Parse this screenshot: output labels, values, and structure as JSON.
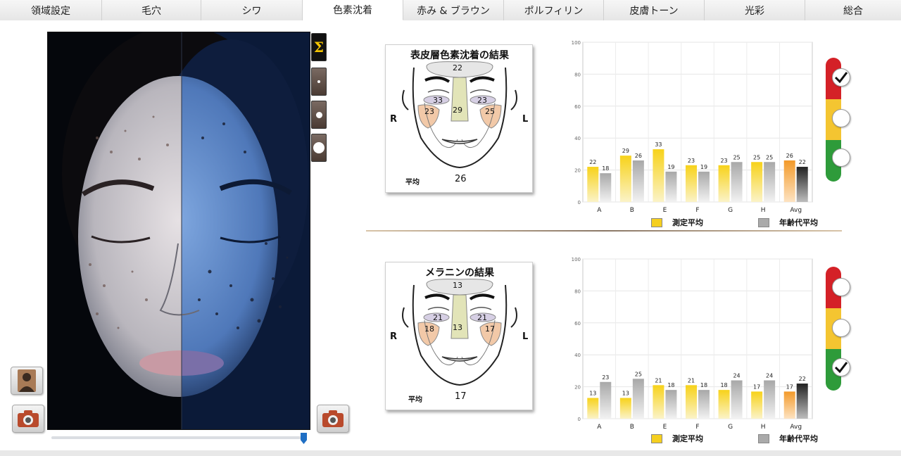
{
  "tabs": [
    {
      "label": "領域設定",
      "active": false
    },
    {
      "label": "毛穴",
      "active": false
    },
    {
      "label": "シワ",
      "active": false
    },
    {
      "label": "色素沈着",
      "active": true
    },
    {
      "label": "赤み & ブラウン",
      "active": false
    },
    {
      "label": "ポルフィリン",
      "active": false
    },
    {
      "label": "皮膚トーン",
      "active": false
    },
    {
      "label": "光彩",
      "active": false
    },
    {
      "label": "総合",
      "active": false
    }
  ],
  "toolbar": {
    "sigma_label": "Σ",
    "icons": [
      "sigma-icon",
      "small-dot-icon",
      "medium-dot-icon",
      "large-dot-icon"
    ]
  },
  "photo": {
    "slider_value": 0.98
  },
  "colors": {
    "measured": "#f5cf1f",
    "age_avg": "#b5b5b5",
    "avg_measured": "#f39a2a",
    "avg_age": "#222222",
    "red": "#d42127",
    "yellow": "#f4c531",
    "green": "#2e9b3a"
  },
  "epidermal": {
    "title": "表皮層色素沈着の結果",
    "left_side": "R",
    "right_side": "L",
    "avg_label": "平均",
    "avg_value": "26",
    "regions": {
      "A": "22",
      "B": "29",
      "E": "33",
      "F": "23",
      "G": "23",
      "H": "25"
    },
    "rating": "red"
  },
  "melanin": {
    "title": "メラニンの結果",
    "left_side": "R",
    "right_side": "L",
    "avg_label": "平均",
    "avg_value": "17",
    "regions": {
      "A": "13",
      "B": "13",
      "E": "21",
      "F": "21",
      "G": "18",
      "H": "17"
    },
    "rating": "green"
  },
  "legend": {
    "measured_label": "測定平均",
    "age_label": "年齢代平均"
  },
  "chart_data": [
    {
      "type": "bar",
      "categories": [
        "A",
        "B",
        "E",
        "F",
        "G",
        "H",
        "Avg"
      ],
      "series": [
        {
          "name": "測定平均",
          "values": [
            22,
            29,
            33,
            23,
            23,
            25,
            26
          ]
        },
        {
          "name": "年齢代平均",
          "values": [
            18,
            26,
            19,
            19,
            25,
            25,
            22
          ]
        }
      ],
      "yticks": [
        0,
        20,
        40,
        60,
        80,
        100
      ],
      "ylim": [
        0,
        100
      ],
      "grid": true,
      "legend": "bottom"
    },
    {
      "type": "bar",
      "categories": [
        "A",
        "B",
        "E",
        "F",
        "G",
        "H",
        "Avg"
      ],
      "series": [
        {
          "name": "測定平均",
          "values": [
            13,
            13,
            21,
            21,
            18,
            17,
            17
          ]
        },
        {
          "name": "年齢代平均",
          "values": [
            23,
            25,
            18,
            18,
            24,
            24,
            22
          ]
        }
      ],
      "yticks": [
        0,
        20,
        40,
        60,
        80,
        100
      ],
      "ylim": [
        0,
        100
      ],
      "grid": true,
      "legend": "bottom"
    }
  ]
}
